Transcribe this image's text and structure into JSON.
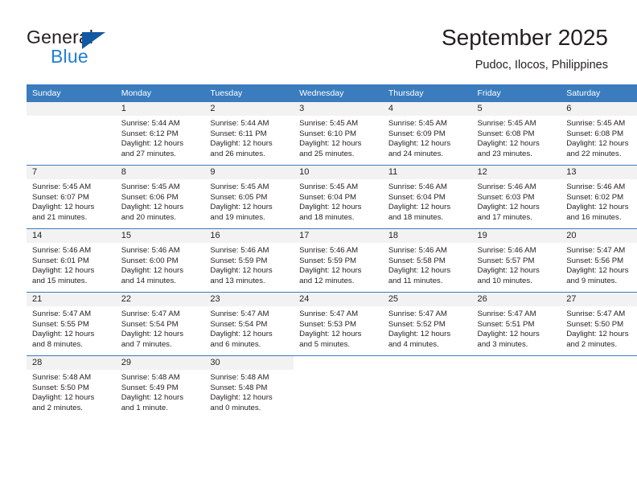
{
  "brand": {
    "name_top": "General",
    "name_bottom": "Blue",
    "accent_color": "#1f7fd4",
    "triangle_color": "#1059a4"
  },
  "header": {
    "title": "September 2025",
    "subtitle": "Pudoc, Ilocos, Philippines"
  },
  "theme": {
    "header_row_bg": "#3a7cbe",
    "daynum_band_bg": "#f2f2f2",
    "grid_line": "#3a7cbe",
    "text": "#231f20"
  },
  "weekday_headers": [
    "Sunday",
    "Monday",
    "Tuesday",
    "Wednesday",
    "Thursday",
    "Friday",
    "Saturday"
  ],
  "labels": {
    "sunrise_prefix": "Sunrise:",
    "sunset_prefix": "Sunset:",
    "daylight_prefix": "Daylight:"
  },
  "weeks": [
    [
      {
        "day": "",
        "empty": true,
        "sunrise": "",
        "sunset": "",
        "daylight_line1": "",
        "daylight_line2": ""
      },
      {
        "day": "1",
        "sunrise": "Sunrise: 5:44 AM",
        "sunset": "Sunset: 6:12 PM",
        "daylight_line1": "Daylight: 12 hours",
        "daylight_line2": "and 27 minutes."
      },
      {
        "day": "2",
        "sunrise": "Sunrise: 5:44 AM",
        "sunset": "Sunset: 6:11 PM",
        "daylight_line1": "Daylight: 12 hours",
        "daylight_line2": "and 26 minutes."
      },
      {
        "day": "3",
        "sunrise": "Sunrise: 5:45 AM",
        "sunset": "Sunset: 6:10 PM",
        "daylight_line1": "Daylight: 12 hours",
        "daylight_line2": "and 25 minutes."
      },
      {
        "day": "4",
        "sunrise": "Sunrise: 5:45 AM",
        "sunset": "Sunset: 6:09 PM",
        "daylight_line1": "Daylight: 12 hours",
        "daylight_line2": "and 24 minutes."
      },
      {
        "day": "5",
        "sunrise": "Sunrise: 5:45 AM",
        "sunset": "Sunset: 6:08 PM",
        "daylight_line1": "Daylight: 12 hours",
        "daylight_line2": "and 23 minutes."
      },
      {
        "day": "6",
        "sunrise": "Sunrise: 5:45 AM",
        "sunset": "Sunset: 6:08 PM",
        "daylight_line1": "Daylight: 12 hours",
        "daylight_line2": "and 22 minutes."
      }
    ],
    [
      {
        "day": "7",
        "sunrise": "Sunrise: 5:45 AM",
        "sunset": "Sunset: 6:07 PM",
        "daylight_line1": "Daylight: 12 hours",
        "daylight_line2": "and 21 minutes."
      },
      {
        "day": "8",
        "sunrise": "Sunrise: 5:45 AM",
        "sunset": "Sunset: 6:06 PM",
        "daylight_line1": "Daylight: 12 hours",
        "daylight_line2": "and 20 minutes."
      },
      {
        "day": "9",
        "sunrise": "Sunrise: 5:45 AM",
        "sunset": "Sunset: 6:05 PM",
        "daylight_line1": "Daylight: 12 hours",
        "daylight_line2": "and 19 minutes."
      },
      {
        "day": "10",
        "sunrise": "Sunrise: 5:45 AM",
        "sunset": "Sunset: 6:04 PM",
        "daylight_line1": "Daylight: 12 hours",
        "daylight_line2": "and 18 minutes."
      },
      {
        "day": "11",
        "sunrise": "Sunrise: 5:46 AM",
        "sunset": "Sunset: 6:04 PM",
        "daylight_line1": "Daylight: 12 hours",
        "daylight_line2": "and 18 minutes."
      },
      {
        "day": "12",
        "sunrise": "Sunrise: 5:46 AM",
        "sunset": "Sunset: 6:03 PM",
        "daylight_line1": "Daylight: 12 hours",
        "daylight_line2": "and 17 minutes."
      },
      {
        "day": "13",
        "sunrise": "Sunrise: 5:46 AM",
        "sunset": "Sunset: 6:02 PM",
        "daylight_line1": "Daylight: 12 hours",
        "daylight_line2": "and 16 minutes."
      }
    ],
    [
      {
        "day": "14",
        "sunrise": "Sunrise: 5:46 AM",
        "sunset": "Sunset: 6:01 PM",
        "daylight_line1": "Daylight: 12 hours",
        "daylight_line2": "and 15 minutes."
      },
      {
        "day": "15",
        "sunrise": "Sunrise: 5:46 AM",
        "sunset": "Sunset: 6:00 PM",
        "daylight_line1": "Daylight: 12 hours",
        "daylight_line2": "and 14 minutes."
      },
      {
        "day": "16",
        "sunrise": "Sunrise: 5:46 AM",
        "sunset": "Sunset: 5:59 PM",
        "daylight_line1": "Daylight: 12 hours",
        "daylight_line2": "and 13 minutes."
      },
      {
        "day": "17",
        "sunrise": "Sunrise: 5:46 AM",
        "sunset": "Sunset: 5:59 PM",
        "daylight_line1": "Daylight: 12 hours",
        "daylight_line2": "and 12 minutes."
      },
      {
        "day": "18",
        "sunrise": "Sunrise: 5:46 AM",
        "sunset": "Sunset: 5:58 PM",
        "daylight_line1": "Daylight: 12 hours",
        "daylight_line2": "and 11 minutes."
      },
      {
        "day": "19",
        "sunrise": "Sunrise: 5:46 AM",
        "sunset": "Sunset: 5:57 PM",
        "daylight_line1": "Daylight: 12 hours",
        "daylight_line2": "and 10 minutes."
      },
      {
        "day": "20",
        "sunrise": "Sunrise: 5:47 AM",
        "sunset": "Sunset: 5:56 PM",
        "daylight_line1": "Daylight: 12 hours",
        "daylight_line2": "and 9 minutes."
      }
    ],
    [
      {
        "day": "21",
        "sunrise": "Sunrise: 5:47 AM",
        "sunset": "Sunset: 5:55 PM",
        "daylight_line1": "Daylight: 12 hours",
        "daylight_line2": "and 8 minutes."
      },
      {
        "day": "22",
        "sunrise": "Sunrise: 5:47 AM",
        "sunset": "Sunset: 5:54 PM",
        "daylight_line1": "Daylight: 12 hours",
        "daylight_line2": "and 7 minutes."
      },
      {
        "day": "23",
        "sunrise": "Sunrise: 5:47 AM",
        "sunset": "Sunset: 5:54 PM",
        "daylight_line1": "Daylight: 12 hours",
        "daylight_line2": "and 6 minutes."
      },
      {
        "day": "24",
        "sunrise": "Sunrise: 5:47 AM",
        "sunset": "Sunset: 5:53 PM",
        "daylight_line1": "Daylight: 12 hours",
        "daylight_line2": "and 5 minutes."
      },
      {
        "day": "25",
        "sunrise": "Sunrise: 5:47 AM",
        "sunset": "Sunset: 5:52 PM",
        "daylight_line1": "Daylight: 12 hours",
        "daylight_line2": "and 4 minutes."
      },
      {
        "day": "26",
        "sunrise": "Sunrise: 5:47 AM",
        "sunset": "Sunset: 5:51 PM",
        "daylight_line1": "Daylight: 12 hours",
        "daylight_line2": "and 3 minutes."
      },
      {
        "day": "27",
        "sunrise": "Sunrise: 5:47 AM",
        "sunset": "Sunset: 5:50 PM",
        "daylight_line1": "Daylight: 12 hours",
        "daylight_line2": "and 2 minutes."
      }
    ],
    [
      {
        "day": "28",
        "sunrise": "Sunrise: 5:48 AM",
        "sunset": "Sunset: 5:50 PM",
        "daylight_line1": "Daylight: 12 hours",
        "daylight_line2": "and 2 minutes."
      },
      {
        "day": "29",
        "sunrise": "Sunrise: 5:48 AM",
        "sunset": "Sunset: 5:49 PM",
        "daylight_line1": "Daylight: 12 hours",
        "daylight_line2": "and 1 minute."
      },
      {
        "day": "30",
        "sunrise": "Sunrise: 5:48 AM",
        "sunset": "Sunset: 5:48 PM",
        "daylight_line1": "Daylight: 12 hours",
        "daylight_line2": "and 0 minutes."
      },
      {
        "day": "",
        "empty": true,
        "blank": true,
        "sunrise": "",
        "sunset": "",
        "daylight_line1": "",
        "daylight_line2": ""
      },
      {
        "day": "",
        "empty": true,
        "blank": true,
        "sunrise": "",
        "sunset": "",
        "daylight_line1": "",
        "daylight_line2": ""
      },
      {
        "day": "",
        "empty": true,
        "blank": true,
        "sunrise": "",
        "sunset": "",
        "daylight_line1": "",
        "daylight_line2": ""
      },
      {
        "day": "",
        "empty": true,
        "blank": true,
        "sunrise": "",
        "sunset": "",
        "daylight_line1": "",
        "daylight_line2": ""
      }
    ]
  ]
}
